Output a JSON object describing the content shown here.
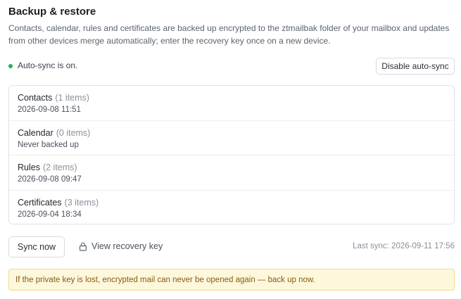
{
  "header": {
    "title": "Backup & restore",
    "description": "Contacts, calendar, rules and certificates are backed up encrypted to the ztmailbak folder of your mailbox and updates from other devices merge automatically; enter the recovery key once on a new device."
  },
  "sync": {
    "status_text": "Auto-sync is on.",
    "status_color": "#1fb35a",
    "disable_label": "Disable auto-sync"
  },
  "items": [
    {
      "name": "Contacts",
      "count": "(1 items)",
      "last_backup": "2026-09-08 11:51"
    },
    {
      "name": "Calendar",
      "count": "(0 items)",
      "last_backup": "Never backed up"
    },
    {
      "name": "Rules",
      "count": "(2 items)",
      "last_backup": "2026-09-08 09:47"
    },
    {
      "name": "Certificates",
      "count": "(3 items)",
      "last_backup": "2026-09-04 18:34"
    }
  ],
  "actions": {
    "sync_now_label": "Sync now",
    "view_key_label": "View recovery key",
    "view_key_icon": "lock-icon",
    "last_sync": "Last sync: 2026-09-11 17:56"
  },
  "warning": {
    "text": "If the private key is lost, encrypted mail can never be opened again — back up now.",
    "background": "#fdf8dc",
    "text_color": "#8a5a12"
  }
}
